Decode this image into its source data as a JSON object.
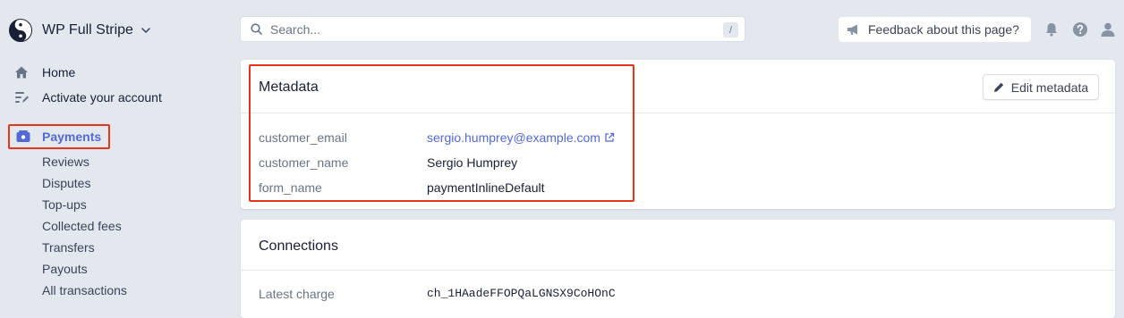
{
  "brand": {
    "name": "WP Full Stripe"
  },
  "sidebar": {
    "home": "Home",
    "activate": "Activate your account",
    "payments": "Payments",
    "sub_items": [
      "Reviews",
      "Disputes",
      "Top-ups",
      "Collected fees",
      "Transfers",
      "Payouts",
      "All transactions"
    ]
  },
  "search": {
    "placeholder": "Search...",
    "shortcut": "/"
  },
  "feedback": {
    "label": "Feedback about this page?"
  },
  "metadata": {
    "title": "Metadata",
    "edit_label": "Edit metadata",
    "rows": [
      {
        "key": "customer_email",
        "value": "sergio.humprey@example.com"
      },
      {
        "key": "customer_name",
        "value": "Sergio Humprey"
      },
      {
        "key": "form_name",
        "value": "paymentInlineDefault"
      }
    ]
  },
  "connections": {
    "title": "Connections",
    "rows": [
      {
        "key": "Latest charge",
        "value": "ch_1HAadeFFOPQaLGNSX9CoHOnC"
      }
    ]
  },
  "colors": {
    "accent": "#5469d4",
    "highlight": "#e8341c",
    "background": "#e3e8ee"
  },
  "icons": [
    "yin-yang-logo",
    "chevron-down-icon",
    "home-icon",
    "activate-icon",
    "payments-icon",
    "search-icon",
    "megaphone-icon",
    "bell-icon",
    "help-icon",
    "user-icon",
    "pencil-icon",
    "external-link-icon"
  ]
}
